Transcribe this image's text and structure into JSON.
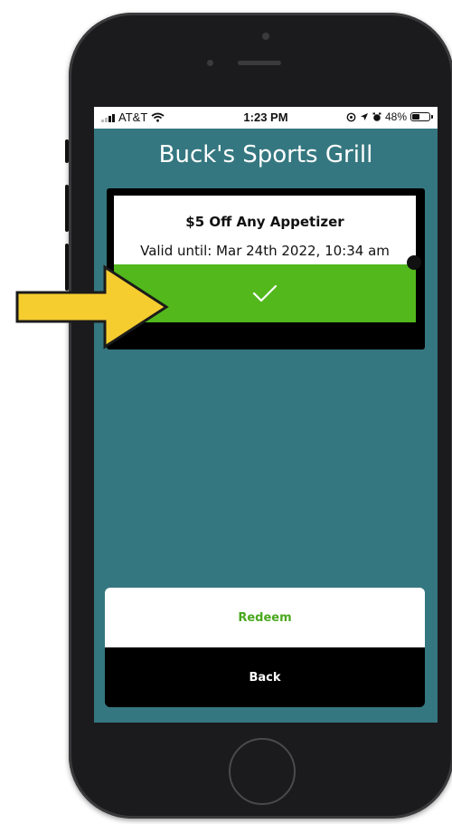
{
  "status_bar": {
    "carrier": "AT&T",
    "time": "1:23 PM",
    "battery": "48%",
    "battery_level": 0.48
  },
  "app": {
    "title": "Buck's Sports Grill"
  },
  "coupon": {
    "title": "$5 Off Any Appetizer",
    "valid_until": "Valid until: Mar 24th 2022, 10:34 am",
    "status_color": "#52b81c",
    "status_icon": "checkmark-icon"
  },
  "actions": {
    "redeem_label": "Redeem",
    "back_label": "Back"
  },
  "colors": {
    "screen_bg": "#357780",
    "accent_green": "#52b81c",
    "arrow_yellow": "#f5cd2f"
  }
}
